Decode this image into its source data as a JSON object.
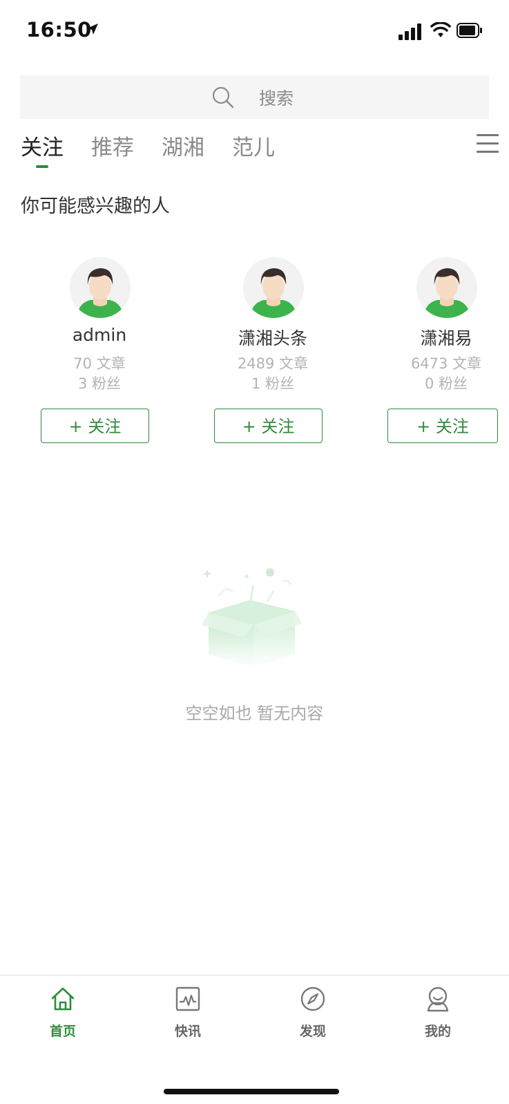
{
  "status_bar": {
    "time": "16:50"
  },
  "search": {
    "placeholder": "搜索"
  },
  "tabs": [
    {
      "label": "关注",
      "active": true
    },
    {
      "label": "推荐",
      "active": false
    },
    {
      "label": "湖湘",
      "active": false
    },
    {
      "label": "范儿",
      "active": false
    }
  ],
  "section": {
    "title": "你可能感兴趣的人"
  },
  "users": [
    {
      "name": "admin",
      "articles": "70 文章",
      "fans": "3 粉丝",
      "follow_label": "+ 关注"
    },
    {
      "name": "潇湘头条",
      "articles": "2489 文章",
      "fans": "1 粉丝",
      "follow_label": "+ 关注"
    },
    {
      "name": "潇湘易",
      "articles": "6473 文章",
      "fans": "0 粉丝",
      "follow_label": "+ 关注"
    }
  ],
  "empty_state": {
    "text": "空空如也 暂无内容"
  },
  "bottom_nav": [
    {
      "label": "首页",
      "icon": "home-icon",
      "active": true
    },
    {
      "label": "快讯",
      "icon": "news-chart-icon",
      "active": false
    },
    {
      "label": "发现",
      "icon": "compass-icon",
      "active": false
    },
    {
      "label": "我的",
      "icon": "user-icon",
      "active": false
    }
  ],
  "colors": {
    "accent": "#2e8b3a",
    "muted": "#8a8a8a"
  }
}
